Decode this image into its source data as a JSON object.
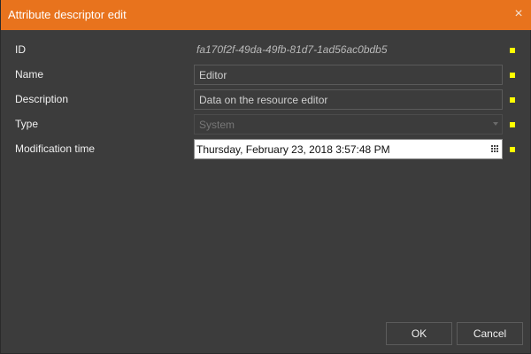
{
  "window": {
    "title": "Attribute descriptor edit",
    "close_glyph": "×",
    "accent_color": "#e8731d"
  },
  "fields": {
    "id": {
      "label": "ID",
      "value": "fa170f2f-49da-49fb-81d7-1ad56ac0bdb5"
    },
    "name": {
      "label": "Name",
      "value": "Editor"
    },
    "description": {
      "label": "Description",
      "value": "Data on the resource editor"
    },
    "type": {
      "label": "Type",
      "value": "System",
      "icon": "chevron-down-icon"
    },
    "modification_time": {
      "label": "Modification time",
      "value": "Thursday, February 23, 2018 3:57:48 PM",
      "icon": "calendar-grid-icon"
    }
  },
  "marker_color": "#ffff00",
  "buttons": {
    "ok_label": "OK",
    "cancel_label": "Cancel"
  }
}
